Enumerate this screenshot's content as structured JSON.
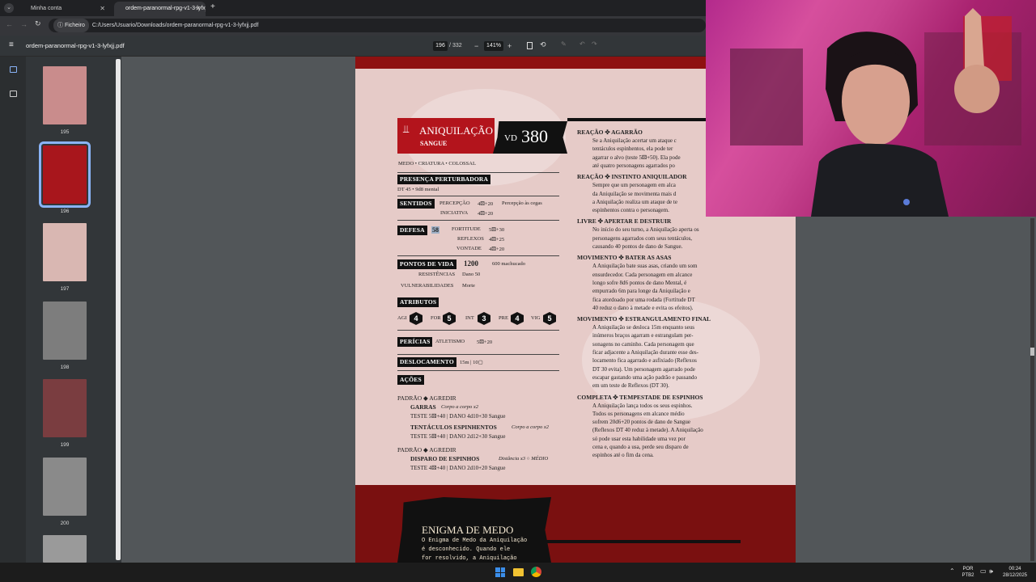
{
  "browser": {
    "tabs": [
      {
        "title": "Minha conta",
        "active": false
      },
      {
        "title": "ordem-paranormal-rpg-v1-3-lyfxjj",
        "active": true
      }
    ],
    "new_tab": "+",
    "address_chip": "Ficheiro",
    "address_url": "C:/Users/Usuario/Downloads/ordem-paranormal-rpg-v1-3-lyfxjj.pdf"
  },
  "pdf_toolbar": {
    "file_name": "ordem-paranormal-rpg-v1-3-lyfxjj.pdf",
    "current_page": "196",
    "page_separator": "/",
    "total_pages": "332",
    "zoom": "141%",
    "zoom_out": "−",
    "zoom_in": "+"
  },
  "sidebar": {
    "thumbnails": [
      {
        "page": "195",
        "color": "#c98c8c"
      },
      {
        "page": "196",
        "color": "#a8161c",
        "selected": true
      },
      {
        "page": "197",
        "color": "#d9b7b2"
      },
      {
        "page": "198",
        "color": "#7d7d7d"
      },
      {
        "page": "199",
        "color": "#7a3d40"
      },
      {
        "page": "200",
        "color": "#8a8a8a"
      },
      {
        "page": "",
        "color": "#9a9a9a"
      }
    ]
  },
  "creature": {
    "name": "Aniquilação",
    "element": "Sangue",
    "vd_label": "VD",
    "vd_value": "380",
    "tags": "MEDO • CRIATURA • COLOSSAL",
    "presence_label": "PRESENÇA PERTURBADORA",
    "presence_value": "DT 45 • 9d8 mental",
    "senses_label": "SENTIDOS",
    "perception_label": "PERCEPÇÃO",
    "perception_value": "4⚄+20",
    "perception_extra": "Percepção às cegas",
    "initiative_label": "INICIATIVA",
    "initiative_value": "4⚄+20",
    "defense_label": "DEFESA",
    "defense_value": "58",
    "fortitude_label": "FORTITUDE",
    "fortitude_value": "5⚄+30",
    "reflexes_label": "REFLEXOS",
    "reflexes_value": "4⚄+25",
    "will_label": "VONTADE",
    "will_value": "4⚄+20",
    "hp_label": "PONTOS DE VIDA",
    "hp_value": "1200",
    "hp_hurt": "600 machucado",
    "resist_label": "RESISTÊNCIAS",
    "resist_value": "Dano 50",
    "vuln_label": "VULNERABILIDADES",
    "vuln_value": "Morte",
    "attributes_label": "ATRIBUTOS",
    "attributes": [
      {
        "name": "AGI",
        "value": "4"
      },
      {
        "name": "FOR",
        "value": "5"
      },
      {
        "name": "INT",
        "value": "3"
      },
      {
        "name": "PRE",
        "value": "4"
      },
      {
        "name": "VIG",
        "value": "5"
      }
    ],
    "skills_label": "PERÍCIAS",
    "skills_name": "ATLETISMO",
    "skills_value": "5⚄+20",
    "move_label": "DESLOCAMENTO",
    "move_value": "15m | 10▢",
    "actions_label": "AÇÕES",
    "action1_type": "PADRÃO ◆ AGREDIR",
    "action1_a_name": "GARRAS",
    "action1_a_note": "Corpo a corpo x2",
    "action1_a_test": "TESTE 5⚄+40 | DANO 4d10+30 Sangue",
    "action1_b_name": "TENTÁCULOS ESPINHENTOS",
    "action1_b_note": "Corpo a corpo x2",
    "action1_b_test": "TESTE 5⚄+40 | DANO 2d12+30 Sangue",
    "action2_type": "PADRÃO ◆ AGREDIR",
    "action2_name": "DISPARO DE ESPINHOS",
    "action2_note": "Distância x3 ○ MÉDIO",
    "action2_test": "TESTE 4⚄+40 | DANO 2d10+20 Sangue",
    "enigma_title": "ENIGMA DE MEDO",
    "enigma_l1": "O Enigma de Medo da Aniquilação",
    "enigma_l2": "é desconhecido. Quando ele",
    "enigma_l3": "for resolvido, a Aniquilação"
  },
  "right_column": [
    {
      "head": "REAÇÃO ✜ AGARRÃO",
      "lines": [
        "Se a Aniquilação acertar um ataque c",
        "tentáculos espinhentos, ela pode ter",
        "agarrar o alvo (teste 5⚄+50). Ela pode",
        "até quatro personagens agarrados po"
      ]
    },
    {
      "head": "REAÇÃO ✜ INSTINTO ANIQUILADOR",
      "lines": [
        "Sempre que um personagem em alca",
        "da Aniquilação se movimenta mais d",
        "a Aniquilação realiza um ataque de te",
        "espinhentos contra o personagem."
      ]
    },
    {
      "head": "LIVRE ✜ APERTAR E DESTRUIR",
      "lines": [
        "No início do seu turno, a Aniquilação aperta os",
        "personagens agarrados com seus tentáculos,",
        "causando 40 pontos de dano de Sangue."
      ]
    },
    {
      "head": "MOVIMENTO ✜ BATER AS ASAS",
      "lines": [
        "A Aniquilação bate suas asas, criando um som",
        "ensurdecedor. Cada personagem em alcance",
        "longo sofre 8d6 pontos de dano Mental, é",
        "empurrado 6m para longe da Aniquilação e",
        "fica atordoado por uma rodada (Fortitude DT",
        "40 reduz o dano à metade e evita os efeitos)."
      ]
    },
    {
      "head": "MOVIMENTO ✜ ESTRANGULAMENTO FINAL",
      "lines": [
        "A Aniquilação se desloca 15m enquanto seus",
        "inúmeros braços agarram e estrangulam per-",
        "sonagens no caminho. Cada personagem que",
        "ficar adjacente a Aniquilação durante esse des-",
        "locamento fica agarrado e asfixiado (Reflexos",
        "DT 30 evita). Um personagem agarrado pode",
        "escapar gastando uma ação padrão e passando",
        "em um teste de Reflexos (DT 30)."
      ]
    },
    {
      "head": "COMPLETA ✜ TEMPESTADE DE ESPINHOS",
      "lines": [
        "A Aniquilação lança todos os seus espinhos.",
        "Todos os personagens em alcance médio",
        "sofrem 20d6+20 pontos de dano de Sangue",
        "(Reflexos DT 40 reduz à metade). A Aniquilação",
        "só pode usar esta habilidade uma vez por",
        "cena e, quando a usa, perde seu disparo de",
        "espinhos até o fim da cena."
      ]
    }
  ],
  "taskbar": {
    "lang_top": "POR",
    "lang_bottom": "PTB2",
    "time": "00:24",
    "date": "28/12/2025"
  }
}
